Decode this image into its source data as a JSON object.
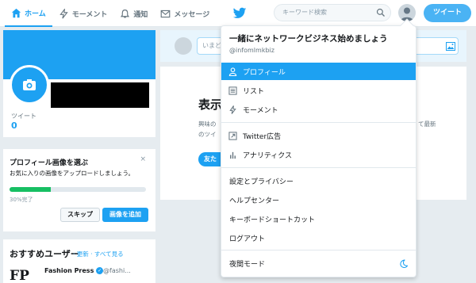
{
  "nav": {
    "home": "ホーム",
    "moments": "モーメント",
    "notifications": "通知",
    "messages": "メッセージ"
  },
  "search": {
    "placeholder": "キーワード検索"
  },
  "tweet_button": "ツイート",
  "profile": {
    "tweets_label": "ツイート",
    "tweets_count": "0"
  },
  "photo_prompt": {
    "title": "プロフィール画像を選ぶ",
    "text": "お気に入りの画像をアップロードしましょう。",
    "progress_label": "30%完了",
    "progress_value": 0.3,
    "skip": "スキップ",
    "add_image": "画像を追加",
    "close": "×"
  },
  "recommended": {
    "title": "おすすめユーザー",
    "links": "· 更新 · すべて見る",
    "user_name": "Fashion Press",
    "user_handle": "@fashi...",
    "logo_text": "FP"
  },
  "compose": {
    "placeholder": "いまど"
  },
  "timeline": {
    "heading": "表示",
    "text_left_1": "興味の",
    "text_left_2": "のツイ",
    "text_right_1": "て最新",
    "text_right_2": "",
    "button": "友た"
  },
  "dropdown": {
    "name": "一緒にネットワークビジネス始めましょう",
    "handle": "@infomlmkbiz",
    "items_group1": [
      "プロフィール",
      "リスト",
      "モーメント"
    ],
    "items_group2": [
      "Twitter広告",
      "アナリティクス"
    ],
    "items_group3": [
      "設定とプライバシー",
      "ヘルプセンター",
      "キーボードショートカット",
      "ログアウト"
    ],
    "night_mode": "夜間モード"
  },
  "colors": {
    "accent": "#1da1f2",
    "progress": "#17bf63"
  }
}
